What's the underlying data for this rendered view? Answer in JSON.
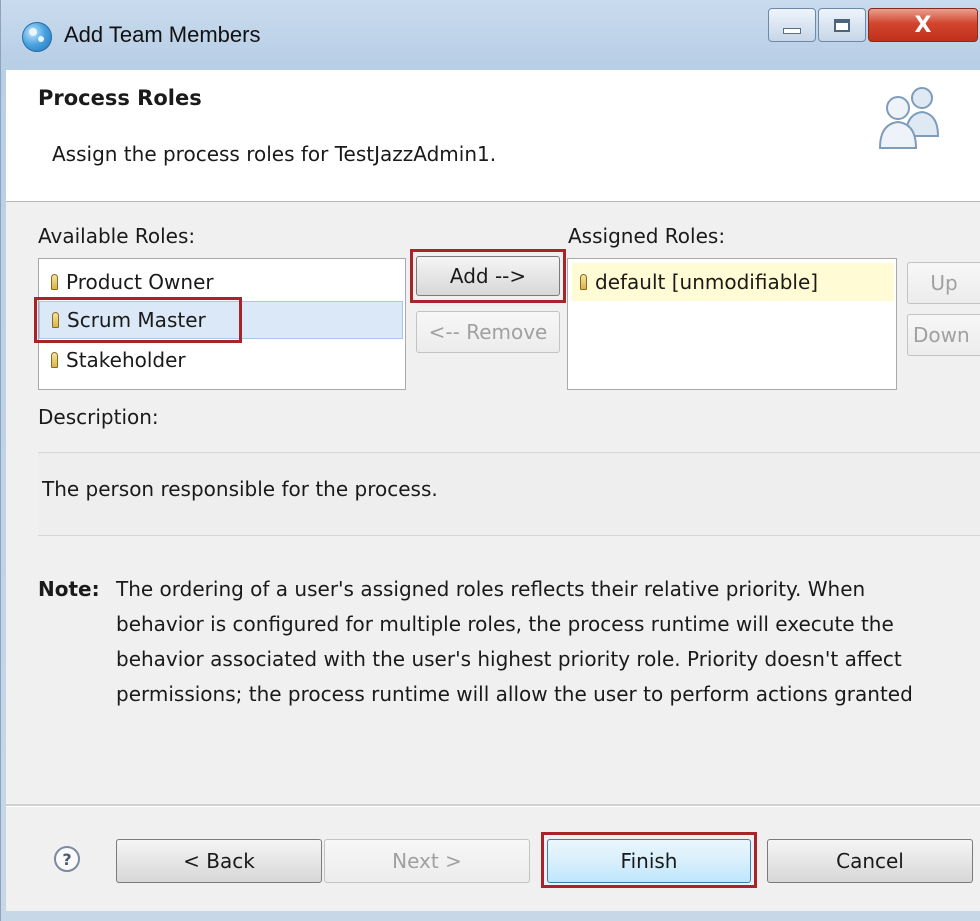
{
  "window": {
    "title": "Add Team Members",
    "close_glyph": "X"
  },
  "header": {
    "title": "Process Roles",
    "subtitle": "Assign the process roles for TestJazzAdmin1.",
    "icon": "people-icon"
  },
  "available_roles": {
    "label": "Available Roles:",
    "items": [
      {
        "label": "Product Owner",
        "selected": false
      },
      {
        "label": "Scrum Master",
        "selected": true
      },
      {
        "label": "Stakeholder",
        "selected": false
      }
    ]
  },
  "transfer_buttons": {
    "add": "Add -->",
    "remove": "<-- Remove"
  },
  "assigned_roles": {
    "label": "Assigned Roles:",
    "items": [
      {
        "label": "default [unmodifiable]"
      }
    ],
    "up": "Up",
    "down": "Down"
  },
  "description": {
    "label": "Description:",
    "text": "The person responsible for the process."
  },
  "note": {
    "label": "Note:",
    "lines": [
      "The ordering of a user's assigned roles reflects their relative priority. When",
      "behavior is configured for multiple roles, the process runtime will execute the",
      "behavior associated with the user's highest priority role. Priority doesn't affect",
      "permissions; the process runtime will allow the user to perform actions granted"
    ]
  },
  "footer": {
    "help": "?",
    "back": "< Back",
    "next": "Next >",
    "finish": "Finish",
    "cancel": "Cancel"
  },
  "colors": {
    "highlight": "#a8242a",
    "selection": "#dbe8f7",
    "assigned_item_bg": "#fffbd4"
  }
}
